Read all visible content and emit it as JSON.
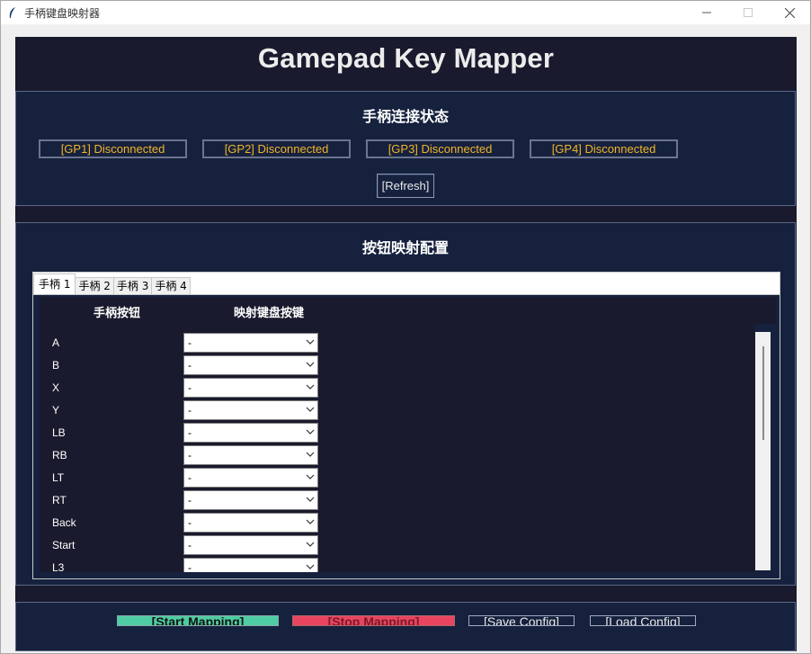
{
  "window": {
    "title": "手柄键盘映射器",
    "icon": "feather-icon",
    "controls": [
      "minimize-icon",
      "maximize-icon",
      "close-icon"
    ]
  },
  "app": {
    "title": "Gamepad Key Mapper"
  },
  "status": {
    "title": "手柄连接状态",
    "gamepads": [
      {
        "label": "[GP1] Disconnected"
      },
      {
        "label": "[GP2] Disconnected"
      },
      {
        "label": "[GP3] Disconnected"
      },
      {
        "label": "[GP4] Disconnected"
      }
    ],
    "refresh_label": "[Refresh]"
  },
  "mapping": {
    "title": "按钮映射配置",
    "tabs": [
      {
        "label": "手柄 1",
        "active": true
      },
      {
        "label": "手柄 2",
        "active": false
      },
      {
        "label": "手柄 3",
        "active": false
      },
      {
        "label": "手柄 4",
        "active": false
      }
    ],
    "col_button": "手柄按钮",
    "col_key": "映射键盘按键",
    "rows": [
      {
        "button": "A",
        "key": "-"
      },
      {
        "button": "B",
        "key": "-"
      },
      {
        "button": "X",
        "key": "-"
      },
      {
        "button": "Y",
        "key": "-"
      },
      {
        "button": "LB",
        "key": "-"
      },
      {
        "button": "RB",
        "key": "-"
      },
      {
        "button": "LT",
        "key": "-"
      },
      {
        "button": "RT",
        "key": "-"
      },
      {
        "button": "Back",
        "key": "-"
      },
      {
        "button": "Start",
        "key": "-"
      },
      {
        "button": "L3",
        "key": "-"
      }
    ]
  },
  "bottom": {
    "start_label": "[Start Mapping]",
    "stop_label": "[Stop Mapping]",
    "save_label": "[Save Config]",
    "load_label": "[Load Config]"
  },
  "colors": {
    "app_bg": "#1a1a2e",
    "panel_bg": "#16213e",
    "status_text": "#f0b429",
    "start_green": "#4ecca3",
    "stop_red": "#e94560"
  }
}
